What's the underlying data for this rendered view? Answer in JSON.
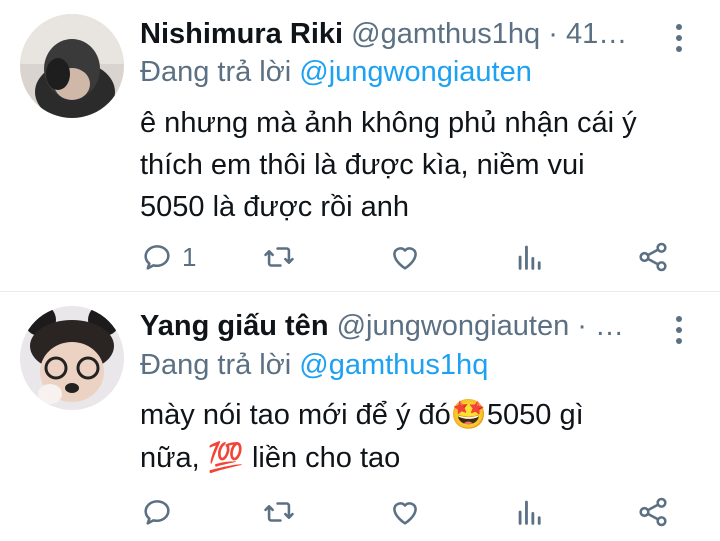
{
  "tweets": [
    {
      "name": "Nishimura Riki",
      "handle": "@gamthus1hq · 41…",
      "reply_prefix": "Đang trả lời",
      "reply_to": "@jungwongiauten",
      "lines": [
        "ê nhưng mà ảnh không phủ nhận cái ý",
        "thích em thôi là được kìa, niềm vui",
        "5050 là được rồi anh"
      ],
      "reply_count": "1"
    },
    {
      "name": "Yang giấu tên",
      "handle": "@jungwongiauten · …",
      "reply_prefix": "Đang trả lời",
      "reply_to": "@gamthus1hq",
      "line1_a": "mày nói tao mới để ý đó",
      "emoji_starstruck": "🤩",
      "line1_b": "5050 gì",
      "line2_a": "nữa, ",
      "emoji_hundred": "💯",
      "line2_b": " liền cho tao",
      "reply_count": ""
    }
  ],
  "colors": {
    "secondary": "#5b7083",
    "accent": "#1da1f2",
    "text": "#0f1419"
  },
  "icons": [
    "reply-icon",
    "retweet-icon",
    "like-icon",
    "analytics-icon",
    "share-icon",
    "more-icon"
  ]
}
